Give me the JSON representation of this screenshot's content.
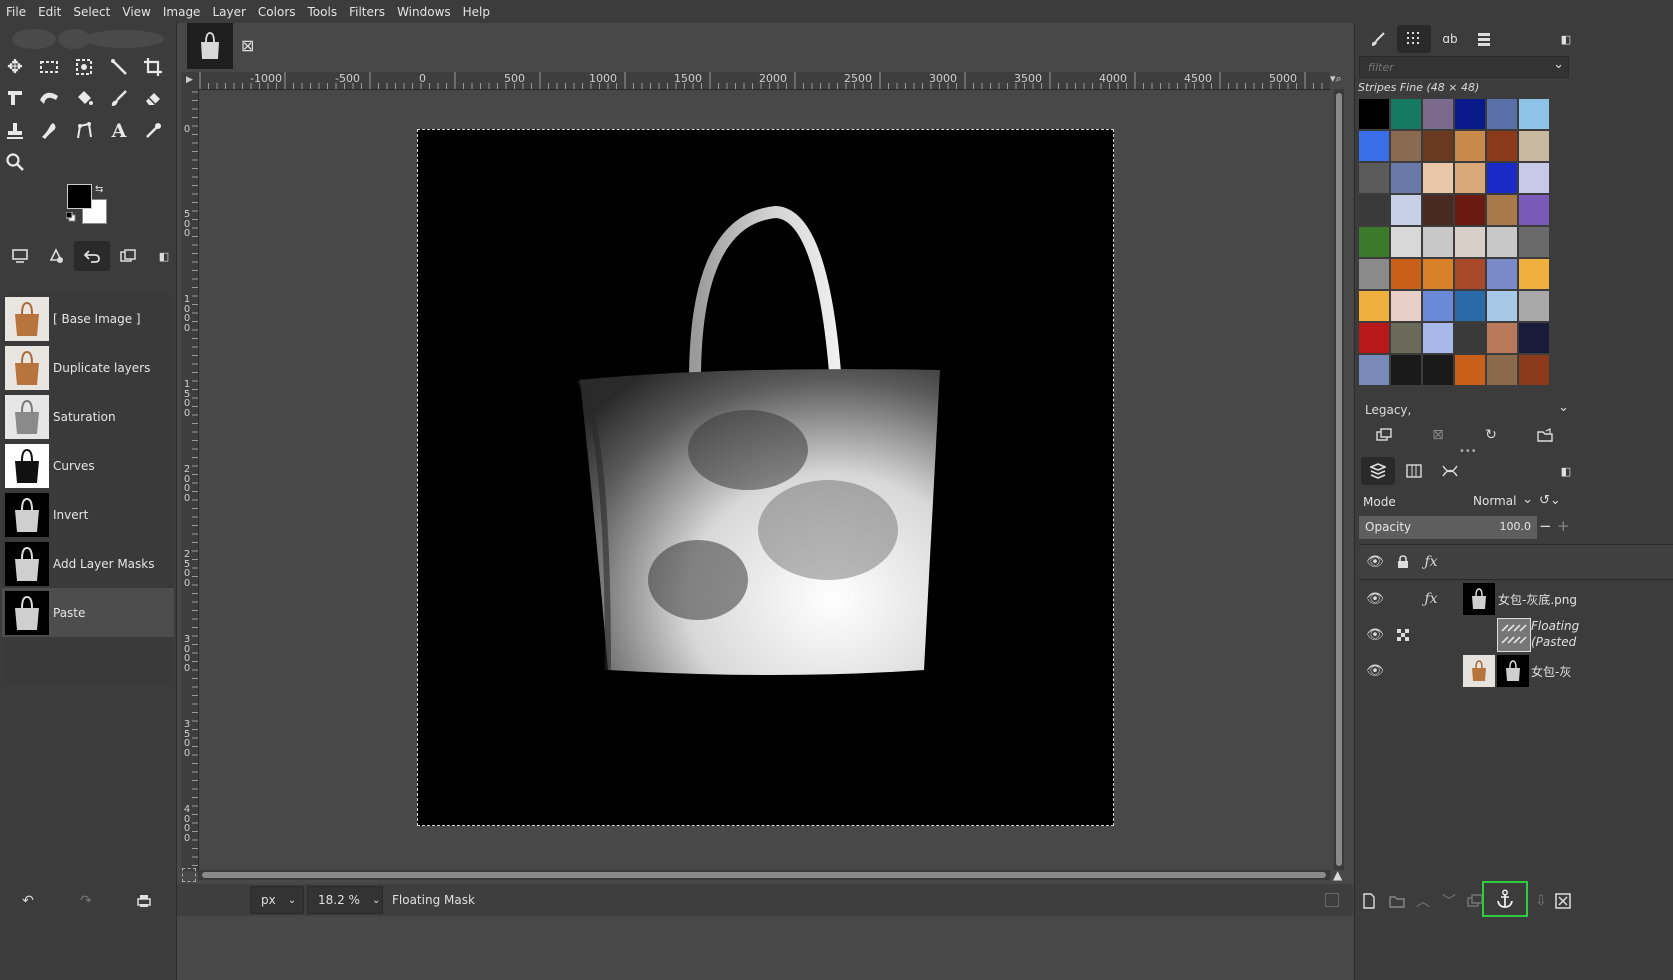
{
  "menu": [
    "File",
    "Edit",
    "Select",
    "View",
    "Image",
    "Layer",
    "Colors",
    "Tools",
    "Filters",
    "Windows",
    "Help"
  ],
  "image_tab": {
    "close_glyph": "⊠"
  },
  "undo_history": [
    {
      "label": "[ Base Image ]",
      "thumb": "brown-bag"
    },
    {
      "label": "Duplicate layers",
      "thumb": "brown-bag"
    },
    {
      "label": "Saturation",
      "thumb": "gray-bag"
    },
    {
      "label": "Curves",
      "thumb": "black-bag-white-bg"
    },
    {
      "label": "Invert",
      "thumb": "white-bag-black-bg"
    },
    {
      "label": "Add Layer Masks",
      "thumb": "white-bag-black-bg"
    },
    {
      "label": "Paste",
      "thumb": "white-bag-black-bg",
      "selected": true
    }
  ],
  "ruler": {
    "h_labels": [
      "-1000",
      "-500",
      "0",
      "500",
      "1000",
      "1500",
      "2000",
      "2500",
      "3000",
      "3500",
      "4000",
      "4500",
      "5000"
    ],
    "v_labels": [
      "0",
      "5 0 0",
      "1 0 0 0",
      "1 5 0 0",
      "2 0 0 0",
      "2 5 0 0",
      "3 0 0 0",
      "3 5 0 0",
      "4 0 0 0"
    ]
  },
  "status": {
    "unit": "px",
    "zoom": "18.2 %",
    "message": "Floating Mask"
  },
  "patterns": {
    "filter_placeholder": "filter",
    "selected_name": "Stripes Fine (48 × 48)",
    "tag_filter": "Legacy,"
  },
  "layers": {
    "mode_label": "Mode",
    "mode_value": "Normal",
    "opacity_label": "Opacity",
    "opacity_value": "100.0",
    "rows": [
      {
        "name": "女包-灰底.png"
      },
      {
        "name_line1": "Floating",
        "name_line2": "(Pasted"
      },
      {
        "name": "女包-灰"
      }
    ]
  },
  "colors": {
    "accent_highlight": "#2ecc40"
  }
}
